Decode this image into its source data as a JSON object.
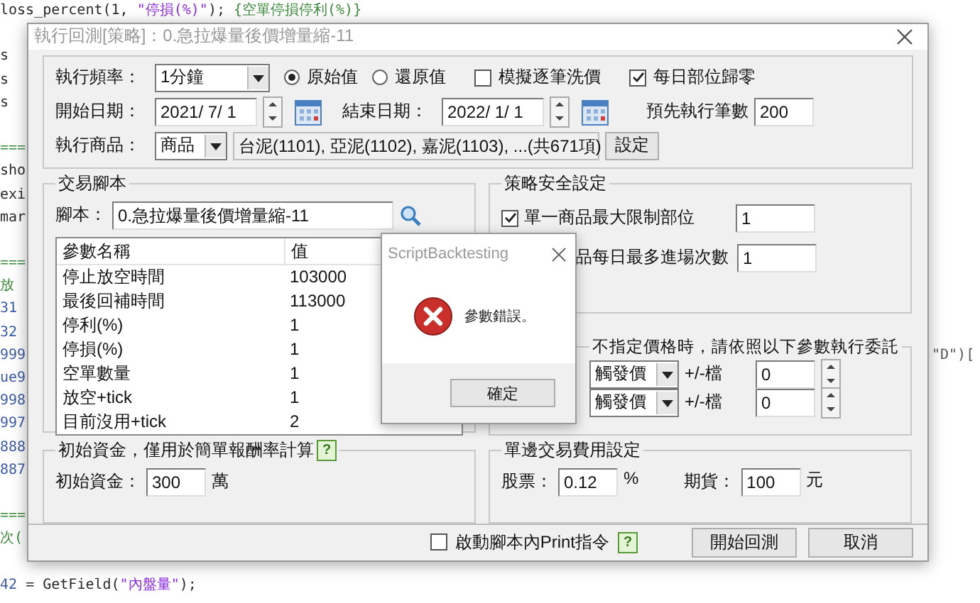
{
  "editor": {
    "lines": [
      {
        "kind": "code",
        "segments": [
          {
            "kind": "plain",
            "text": "loss_percent(1, "
          },
          {
            "kind": "string",
            "text": "\"停損(%)\""
          },
          {
            "kind": "plain",
            "text": "); "
          },
          {
            "kind": "comment",
            "text": "{空單停損停利(%)}"
          }
        ]
      },
      {
        "kind": "blank"
      },
      {
        "kind": "code",
        "segments": [
          {
            "kind": "plain",
            "text": "s"
          }
        ]
      },
      {
        "kind": "code",
        "segments": [
          {
            "kind": "plain",
            "text": "s"
          }
        ]
      },
      {
        "kind": "code",
        "segments": [
          {
            "kind": "plain",
            "text": "s"
          }
        ]
      },
      {
        "kind": "blank"
      },
      {
        "kind": "code",
        "segments": [
          {
            "kind": "comment",
            "text": "==="
          }
        ]
      },
      {
        "kind": "code",
        "segments": [
          {
            "kind": "plain",
            "text": "sho"
          }
        ]
      },
      {
        "kind": "code",
        "segments": [
          {
            "kind": "plain",
            "text": "exi"
          }
        ]
      },
      {
        "kind": "code",
        "segments": [
          {
            "kind": "plain",
            "text": "mar"
          }
        ]
      },
      {
        "kind": "blank"
      },
      {
        "kind": "code",
        "segments": [
          {
            "kind": "comment",
            "text": "==="
          }
        ]
      },
      {
        "kind": "code",
        "segments": [
          {
            "kind": "comment",
            "text": "放"
          }
        ]
      },
      {
        "kind": "code",
        "segments": [
          {
            "kind": "number",
            "text": "31"
          }
        ]
      },
      {
        "kind": "code",
        "segments": [
          {
            "kind": "number",
            "text": "32"
          }
        ]
      },
      {
        "kind": "code",
        "segments": [
          {
            "kind": "number",
            "text": "999"
          }
        ],
        "right": "\"D\")["
      },
      {
        "kind": "code",
        "segments": [
          {
            "kind": "number",
            "text": "ue9"
          }
        ]
      },
      {
        "kind": "code",
        "segments": [
          {
            "kind": "number",
            "text": "998"
          }
        ]
      },
      {
        "kind": "code",
        "segments": [
          {
            "kind": "number",
            "text": "997"
          }
        ]
      },
      {
        "kind": "code",
        "segments": [
          {
            "kind": "number",
            "text": "888"
          }
        ]
      },
      {
        "kind": "code",
        "segments": [
          {
            "kind": "number",
            "text": "887"
          }
        ]
      },
      {
        "kind": "blank"
      },
      {
        "kind": "code",
        "segments": [
          {
            "kind": "comment",
            "text": "==="
          }
        ]
      },
      {
        "kind": "code",
        "segments": [
          {
            "kind": "comment",
            "text": "次("
          }
        ]
      },
      {
        "kind": "blank"
      },
      {
        "kind": "code",
        "segments": [
          {
            "kind": "number",
            "text": "42"
          },
          {
            "kind": "plain",
            "text": " = GetField("
          },
          {
            "kind": "string",
            "text": "\"內盤量\""
          },
          {
            "kind": "plain",
            "text": ");"
          }
        ]
      }
    ]
  },
  "dialog": {
    "title": "執行回測[策略]：0.急拉爆量後價增量縮-11",
    "frequency": {
      "label": "執行頻率：",
      "value": "1分鐘"
    },
    "price_modes": [
      {
        "label": "原始值",
        "selected": true
      },
      {
        "label": "還原值",
        "selected": false
      }
    ],
    "options": [
      {
        "label": "模擬逐筆洗價",
        "checked": false
      },
      {
        "label": "每日部位歸零",
        "checked": true
      }
    ],
    "start_date": {
      "label": "開始日期：",
      "value": "2021/ 7/ 1"
    },
    "end_date": {
      "label": "結束日期：",
      "value": "2022/ 1/ 1"
    },
    "preload": {
      "label": "預先執行筆數",
      "value": "200"
    },
    "products": {
      "label": "執行商品：",
      "type": "商品",
      "value": "台泥(1101), 亞泥(1102), 嘉泥(1103), ...(共671項)",
      "button": "設定"
    },
    "script_group": {
      "title": "交易腳本",
      "label": "腳本：",
      "value": "0.急拉爆量後價增量縮-11",
      "columns": [
        "參數名稱",
        "值"
      ],
      "rows": [
        [
          "停止放空時間",
          "103000"
        ],
        [
          "最後回補時間",
          "113000"
        ],
        [
          "停利(%)",
          "1"
        ],
        [
          "停損(%)",
          "1"
        ],
        [
          "空單數量",
          "1"
        ],
        [
          "放空+tick",
          "1"
        ],
        [
          "目前沒用+tick",
          "2"
        ]
      ]
    },
    "safety_group": {
      "title": "策略安全設定",
      "rows": [
        {
          "label": "單一商品最大限制部位",
          "checked": true,
          "value": "1"
        },
        {
          "label": "品每日最多進場次數",
          "value": "1"
        }
      ]
    },
    "order_group": {
      "title": "不指定價格時，請依照以下參數執行委託",
      "rows": [
        {
          "price": "觸發價",
          "unit": "+/-檔",
          "value": "0"
        },
        {
          "price": "觸發價",
          "unit": "+/-檔",
          "value": "0"
        }
      ]
    },
    "capital_group": {
      "title": "初始資金，僅用於簡單報酬率計算",
      "help": "?",
      "label": "初始資金：",
      "value": "300",
      "unit": "萬"
    },
    "fee_group": {
      "title": "單邊交易費用設定",
      "stock_label": "股票：",
      "stock_value": "0.12",
      "stock_unit": "%",
      "futures_label": "期貨：",
      "futures_value": "100",
      "futures_unit": "元"
    },
    "print_option": {
      "label": "啟動腳本內Print指令",
      "checked": false,
      "help": "?"
    },
    "buttons": [
      "開始回測",
      "取消"
    ]
  },
  "alert": {
    "title": "ScriptBacktesting",
    "message": "參數錯誤。",
    "button": "確定"
  }
}
